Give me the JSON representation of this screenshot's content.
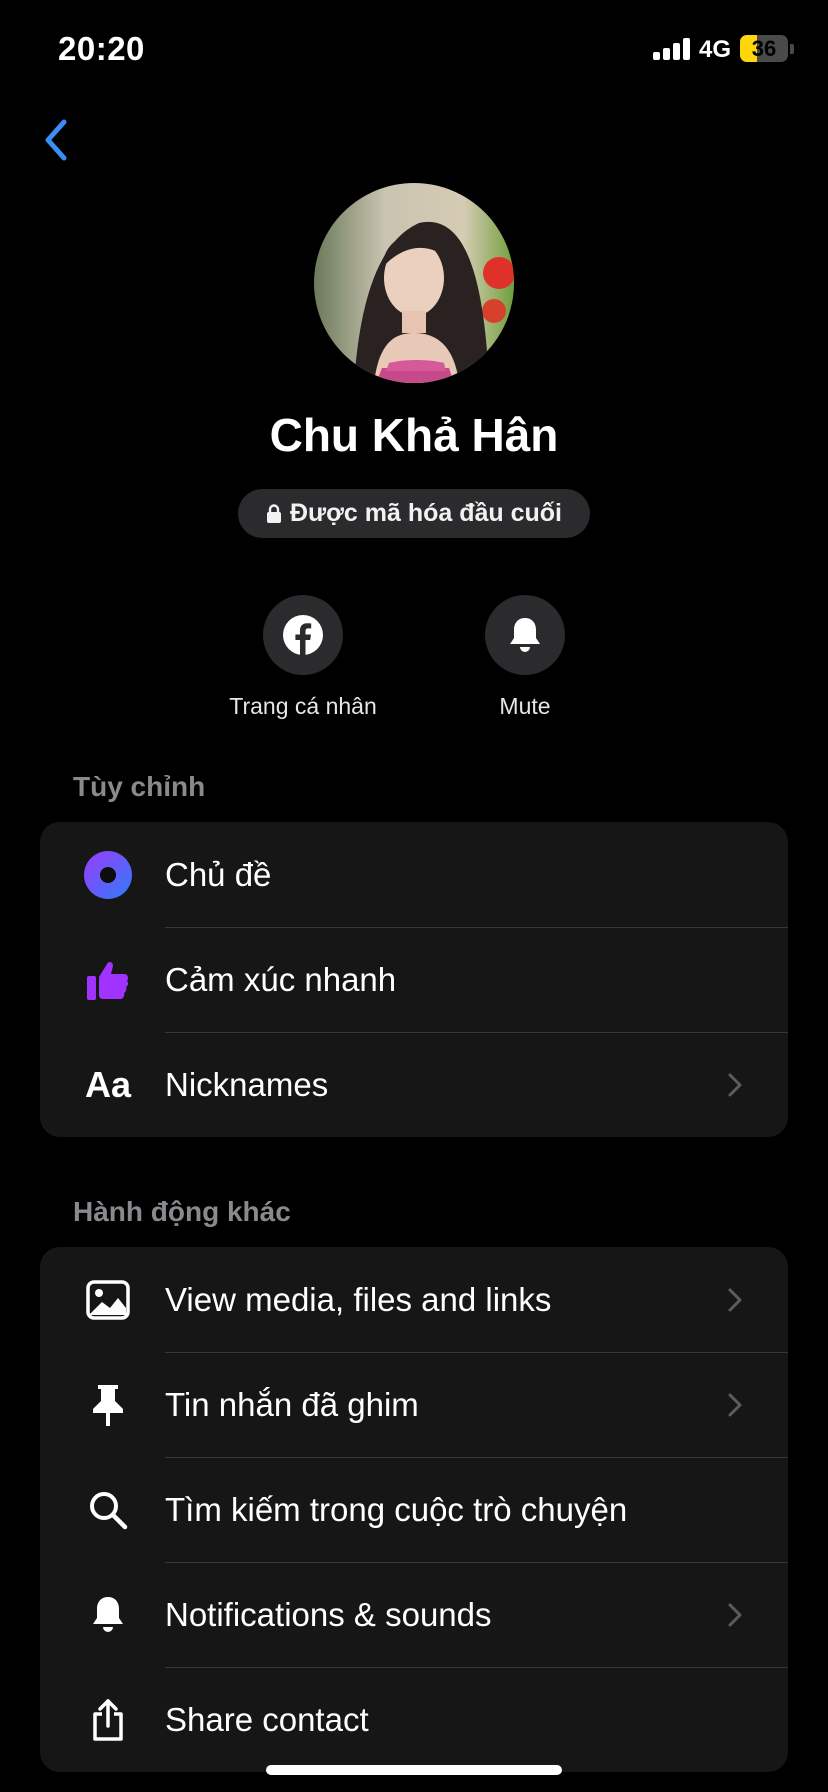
{
  "status_bar": {
    "time": "20:20",
    "network": "4G",
    "battery": "36",
    "battery_level": 0.36
  },
  "profile": {
    "name": "Chu Khả Hân",
    "encryption_label": "Được mã hóa đầu cuối"
  },
  "actions": [
    {
      "label": "Trang cá nhân",
      "icon": "facebook-icon"
    },
    {
      "label": "Mute",
      "icon": "bell-icon"
    }
  ],
  "sections": {
    "customize": {
      "title": "Tùy chỉnh",
      "items": [
        {
          "label": "Chủ đề",
          "icon": "theme-icon",
          "chevron": false
        },
        {
          "label": "Cảm xúc nhanh",
          "icon": "thumbs-up-icon",
          "chevron": false
        },
        {
          "label": "Nicknames",
          "icon": "text-aa-icon",
          "chevron": true
        }
      ]
    },
    "other_actions": {
      "title": "Hành động khác",
      "items": [
        {
          "label": "View media, files and links",
          "icon": "image-icon",
          "chevron": true
        },
        {
          "label": "Tin nhắn đã ghim",
          "icon": "pin-icon",
          "chevron": true
        },
        {
          "label": "Tìm kiếm trong cuộc trò chuyện",
          "icon": "search-icon",
          "chevron": false
        },
        {
          "label": "Notifications & sounds",
          "icon": "bell-icon",
          "chevron": true
        },
        {
          "label": "Share contact",
          "icon": "share-icon",
          "chevron": false
        }
      ]
    }
  },
  "colors": {
    "accent": "#3a8ff5",
    "theme_gradient_start": "#8a3ffc",
    "theme_gradient_end": "#3a6ff5",
    "thumbs_up": "#a033ff"
  }
}
